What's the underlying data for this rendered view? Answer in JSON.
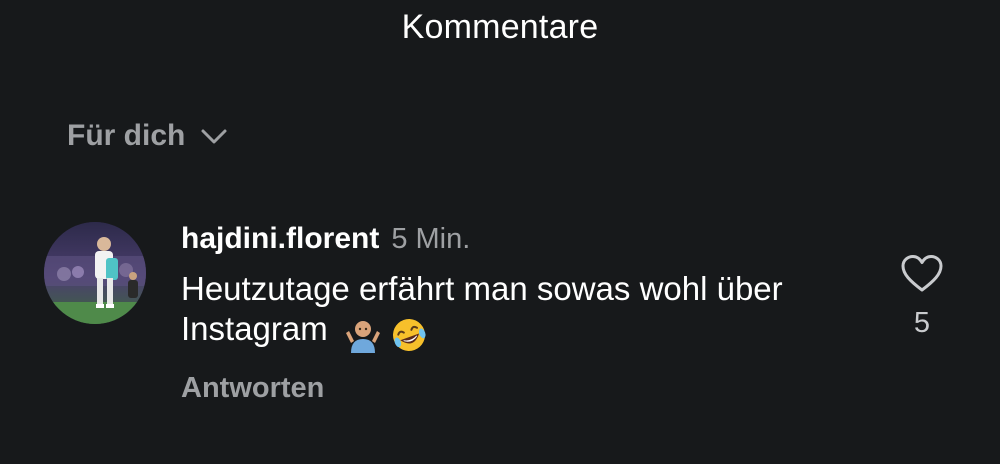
{
  "header": {
    "title": "Kommentare"
  },
  "sort": {
    "label": "Für dich",
    "icon": "chevron-down-icon"
  },
  "comment": {
    "username": "hajdini.florent",
    "timestamp": "5 Min.",
    "text": "Heutzutage erfährt man sowas wohl über Instagram",
    "emojis": [
      "person-shrugging-emoji",
      "rolling-on-floor-laughing-emoji"
    ],
    "reply_label": "Antworten",
    "like_count": "5",
    "like_icon": "heart-outline-icon"
  },
  "colors": {
    "background": "#17191b",
    "primary_text": "#ffffff",
    "secondary_text": "#9ea0a3",
    "like_count": "#c9cbce"
  }
}
